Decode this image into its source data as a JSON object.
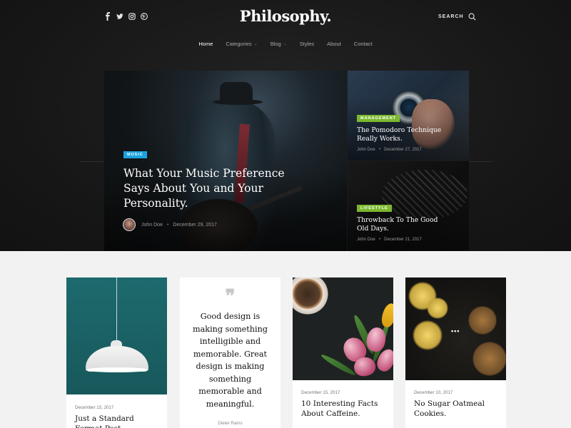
{
  "colors": {
    "music_tag": "#1aa3e0",
    "management_tag": "#7cb82f",
    "lifestyle_tag": "#7cb82f"
  },
  "header": {
    "logo": "Philosophy.",
    "search_label": "SEARCH",
    "social_icons": [
      "facebook-icon",
      "twitter-icon",
      "instagram-icon",
      "pinterest-icon"
    ]
  },
  "nav": {
    "items": [
      {
        "label": "Home",
        "active": true
      },
      {
        "label": "Categories",
        "has_dropdown": true
      },
      {
        "label": "Blog",
        "has_dropdown": true
      },
      {
        "label": "Styles"
      },
      {
        "label": "About"
      },
      {
        "label": "Contact"
      }
    ]
  },
  "featured": {
    "main": {
      "tag": "MUSIC",
      "title": "What Your Music Preference Says About You and Your Personality.",
      "author": "John Doe",
      "date": "December 29, 2017"
    },
    "side": [
      {
        "tag": "MANAGEMENT",
        "title": "The Pomodoro Technique Really Works.",
        "author": "John Doe",
        "date": "December 27, 2017"
      },
      {
        "tag": "LIFESTYLE",
        "title": "Throwback To The Good Old Days.",
        "author": "John Doe",
        "date": "December 21, 2017"
      }
    ]
  },
  "cards": {
    "lamp": {
      "date": "December 15, 2017",
      "title": "Just a Standard Format Post."
    },
    "quote": {
      "text": "Good design is making something intelligible and memorable. Great design is making something memorable and meaningful.",
      "author": "Dieter Rams"
    },
    "coffee": {
      "date": "December 15, 2017",
      "title": "10 Interesting Facts About Caffeine."
    },
    "oatmeal": {
      "date": "December 10, 2017",
      "title": "No Sugar Oatmeal Cookies."
    }
  }
}
